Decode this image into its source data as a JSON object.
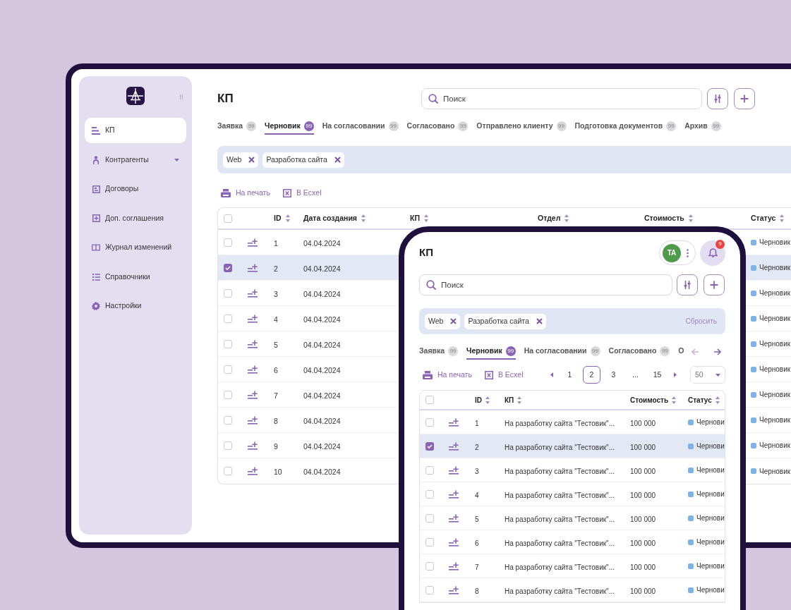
{
  "desktop": {
    "sidebar": {
      "items": [
        {
          "label": "КП",
          "selected": true,
          "expandable": false
        },
        {
          "label": "Контрагенты",
          "selected": false,
          "expandable": true
        },
        {
          "label": "Договоры",
          "selected": false,
          "expandable": false
        },
        {
          "label": "Доп. соглашения",
          "selected": false,
          "expandable": false
        },
        {
          "label": "Журнал изменений",
          "selected": false,
          "expandable": false
        },
        {
          "label": "Справочники",
          "selected": false,
          "expandable": false
        },
        {
          "label": "Настройки",
          "selected": false,
          "expandable": false
        }
      ]
    },
    "title": "КП",
    "search": {
      "placeholder": "Поиск"
    },
    "tabs": [
      {
        "label": "Заявка",
        "count": "99",
        "selected": false
      },
      {
        "label": "Черновик",
        "count": "99",
        "selected": true
      },
      {
        "label": "На согласовании",
        "count": "99",
        "selected": false
      },
      {
        "label": "Согласовано",
        "count": "99",
        "selected": false
      },
      {
        "label": "Отправлено клиенту",
        "count": "99",
        "selected": false
      },
      {
        "label": "Подготовка документов",
        "count": "99",
        "selected": false
      },
      {
        "label": "Архив",
        "count": "99",
        "selected": false
      }
    ],
    "filters": [
      {
        "label": "Web"
      },
      {
        "label": "Разработка сайта"
      }
    ],
    "actions": [
      "На печать",
      "В Ecxel"
    ],
    "table": {
      "all_checked": false,
      "columns": [
        "ID",
        "Дата создания",
        "КП",
        "Отдел",
        "Стоимость",
        "Статус"
      ],
      "rows": [
        {
          "checked": false,
          "id": "1",
          "date": "04.04.2024",
          "status": "Черновик"
        },
        {
          "checked": true,
          "id": "2",
          "date": "04.04.2024",
          "status": "Черновик"
        },
        {
          "checked": false,
          "id": "3",
          "date": "04.04.2024",
          "status": "Черновик"
        },
        {
          "checked": false,
          "id": "4",
          "date": "04.04.2024",
          "status": "Черновик"
        },
        {
          "checked": false,
          "id": "5",
          "date": "04.04.2024",
          "status": "Черновик"
        },
        {
          "checked": false,
          "id": "6",
          "date": "04.04.2024",
          "status": "Черновик"
        },
        {
          "checked": false,
          "id": "7",
          "date": "04.04.2024",
          "status": "Черновик"
        },
        {
          "checked": false,
          "id": "8",
          "date": "04.04.2024",
          "status": "Черновик"
        },
        {
          "checked": false,
          "id": "9",
          "date": "04.04.2024",
          "status": "Черновик"
        },
        {
          "checked": false,
          "id": "10",
          "date": "04.04.2024",
          "status": "Черновик"
        }
      ]
    }
  },
  "mobile": {
    "title": "КП",
    "user": {
      "initials": "ТА"
    },
    "notifications": {
      "count": "9"
    },
    "search": {
      "placeholder": "Поиск"
    },
    "filters": [
      {
        "label": "Web"
      },
      {
        "label": "Разработка сайта"
      }
    ],
    "reset": "Сбросить",
    "tabs": [
      {
        "label": "Заявка",
        "count": "99",
        "selected": false
      },
      {
        "label": "Черновик",
        "count": "99",
        "selected": true
      },
      {
        "label": "На согласовании",
        "count": "99",
        "selected": false
      },
      {
        "label": "Согласовано",
        "count": "99",
        "selected": false
      },
      {
        "label": "О",
        "selected": false
      }
    ],
    "actions": [
      "На печать",
      "В Ecxel"
    ],
    "pagination": [
      {
        "label": "1",
        "selected": false
      },
      {
        "label": "2",
        "selected": true
      },
      {
        "label": "3",
        "selected": false
      },
      {
        "label": "...",
        "selected": false
      },
      {
        "label": "15",
        "selected": false
      }
    ],
    "page_size": "50",
    "table": {
      "all_checked": false,
      "columns": [
        "ID",
        "КП",
        "Стоимость",
        "Статус"
      ],
      "rows": [
        {
          "checked": false,
          "id": "1",
          "title": "На разработку сайта \"Тестовик\"...",
          "cost": "100 000",
          "status": "Чернови"
        },
        {
          "checked": true,
          "id": "2",
          "title": "На разработку сайта \"Тестовик\"...",
          "cost": "100 000",
          "status": "Чернови"
        },
        {
          "checked": false,
          "id": "3",
          "title": "На разработку сайта \"Тестовик\"...",
          "cost": "100 000",
          "status": "Чернови"
        },
        {
          "checked": false,
          "id": "4",
          "title": "На разработку сайта \"Тестовик\"...",
          "cost": "100 000",
          "status": "Чернови"
        },
        {
          "checked": false,
          "id": "5",
          "title": "На разработку сайта \"Тестовик\"...",
          "cost": "100 000",
          "status": "Чернови"
        },
        {
          "checked": false,
          "id": "6",
          "title": "На разработку сайта \"Тестовик\"...",
          "cost": "100 000",
          "status": "Чернови"
        },
        {
          "checked": false,
          "id": "7",
          "title": "На разработку сайта \"Тестовик\"...",
          "cost": "100 000",
          "status": "Чернови"
        },
        {
          "checked": false,
          "id": "8",
          "title": "На разработку сайта \"Тестовик\"...",
          "cost": "100 000",
          "status": "Чернови"
        }
      ]
    }
  }
}
